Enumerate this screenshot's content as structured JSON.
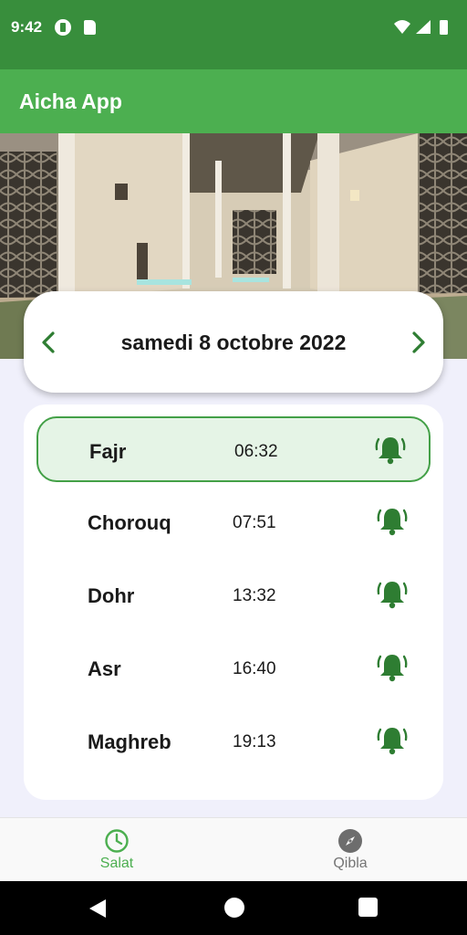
{
  "status_bar": {
    "time": "9:42",
    "icons": [
      "notification-app-icon",
      "sd-card-icon",
      "wifi-icon",
      "signal-icon",
      "battery-icon"
    ]
  },
  "app_bar": {
    "title": "Aicha App"
  },
  "banner": {
    "image": "mosque-interior-photo"
  },
  "date_selector": {
    "date": "samedi 8 octobre 2022",
    "prev_icon": "chevron-left-icon",
    "next_icon": "chevron-right-icon"
  },
  "prayers": [
    {
      "name": "Fajr",
      "time": "06:32",
      "active": true
    },
    {
      "name": "Chorouq",
      "time": "07:51",
      "active": false
    },
    {
      "name": "Dohr",
      "time": "13:32",
      "active": false
    },
    {
      "name": "Asr",
      "time": "16:40",
      "active": false
    },
    {
      "name": "Maghreb",
      "time": "19:13",
      "active": false
    }
  ],
  "bottom_nav": {
    "items": [
      {
        "label": "Salat",
        "icon": "clock-icon",
        "selected": true
      },
      {
        "label": "Qibla",
        "icon": "compass-icon",
        "selected": false
      }
    ]
  },
  "colors": {
    "status_bar": "#388e3c",
    "app_bar": "#4caf50",
    "accent": "#2e7d32",
    "active_row_bg": "#e5f4e6"
  }
}
